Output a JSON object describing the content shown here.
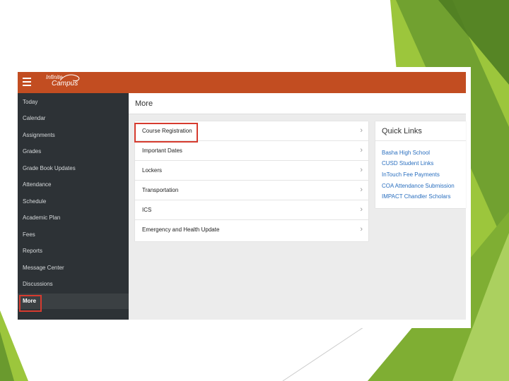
{
  "colors": {
    "topbar": "#c24d21",
    "sidebar": "#2d3236",
    "highlight_box": "#d63b2f",
    "link": "#2a6fbf",
    "slide_green_dark": "#6a9a2e",
    "slide_green_light": "#9cc63c"
  },
  "app": {
    "logo_line1": "Infinite",
    "logo_line2": "Campus",
    "menu_icon": "hamburger-icon"
  },
  "sidebar": {
    "items": [
      {
        "label": "Today"
      },
      {
        "label": "Calendar"
      },
      {
        "label": "Assignments"
      },
      {
        "label": "Grades"
      },
      {
        "label": "Grade Book Updates"
      },
      {
        "label": "Attendance"
      },
      {
        "label": "Schedule"
      },
      {
        "label": "Academic Plan"
      },
      {
        "label": "Fees"
      },
      {
        "label": "Reports"
      },
      {
        "label": "Message Center"
      },
      {
        "label": "Discussions"
      },
      {
        "label": "More",
        "active": true
      }
    ]
  },
  "main": {
    "title": "More",
    "menu": [
      {
        "label": "Course Registration"
      },
      {
        "label": "Important Dates"
      },
      {
        "label": "Lockers"
      },
      {
        "label": "Transportation"
      },
      {
        "label": "ICS"
      },
      {
        "label": "Emergency and Health Update"
      }
    ],
    "chevron_icon": "chevron-right-icon"
  },
  "quick_links": {
    "title": "Quick Links",
    "links": [
      "Basha High School",
      "CUSD Student Links",
      "InTouch Fee Payments",
      "COA Attendance Submission",
      "IMPACT Chandler Scholars"
    ]
  }
}
